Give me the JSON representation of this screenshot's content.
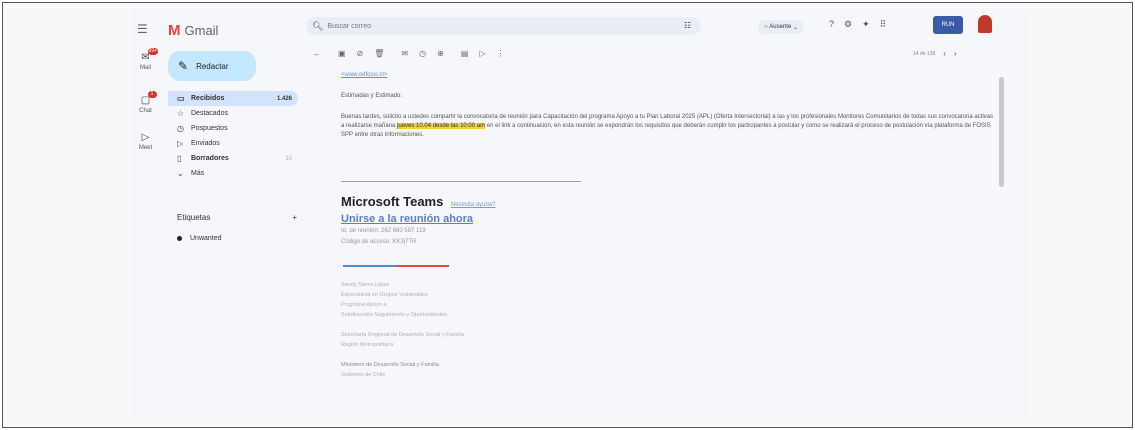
{
  "app": {
    "name": "Gmail"
  },
  "rail": {
    "items": [
      {
        "label": "Mail",
        "badge": "99+"
      },
      {
        "label": "Chat",
        "badge": "1"
      },
      {
        "label": "Meet",
        "badge": ""
      }
    ]
  },
  "compose": {
    "label": "Redactar"
  },
  "nav": {
    "items": [
      {
        "label": "Recibidos",
        "count": "1.426",
        "icon": "inbox-icon"
      },
      {
        "label": "Destacados",
        "count": "",
        "icon": "star-icon"
      },
      {
        "label": "Pospuestos",
        "count": "",
        "icon": "clock-icon"
      },
      {
        "label": "Enviados",
        "count": "",
        "icon": "send-icon"
      },
      {
        "label": "Borradores",
        "count": "10",
        "icon": "draft-icon"
      },
      {
        "label": "Más",
        "count": "",
        "icon": "chevron-down-icon"
      }
    ]
  },
  "labels": {
    "heading": "Etiquetas",
    "add": "+",
    "items": [
      "Unwanted"
    ]
  },
  "search": {
    "placeholder": "Buscar correo"
  },
  "status": {
    "label": "Ausente"
  },
  "user": {
    "org": "RUN"
  },
  "pager": {
    "text": "14 de 138"
  },
  "email": {
    "link": "<www.odfosis.cl>",
    "greeting": "Estimadas y Estimado:",
    "body_before": "Buenas tardes, solicito a ustedes compartir la convocatoria de reunión para Capacitación del programa Apoyo a tu Plan Laboral 2025 (APL) (Oferta Intersectorial) a las y los profesionales Monitores Comunitarios de todas sus convocatoria activas a realizarse mañana ",
    "body_highlight": "jueves 10.04 desde las 10:00 am",
    "body_after": " en el link a continuación, en esta reunión se expondrán los requisitos que deberán cumplir los participantes a postular y como se realizará el proceso de postulación vía plataforma de FOSIS SPP entre otras informaciones."
  },
  "teams": {
    "title": "Microsoft Teams",
    "help": "Necesita ayuda?",
    "join": "Unirse a la reunión ahora",
    "meeting_id": "Id. de reunión: 262 680 587 119",
    "passcode": "Código de acceso: KK3j7TR"
  },
  "signature": {
    "lines": [
      "Sandy Sierra López",
      "Especialista en Grupos Vulnerables",
      "Programa Apoyo a",
      "Subdirección Seguimiento y Oportunidades",
      "",
      "Secretaría Regional de Desarrollo Social y Familia",
      "Región Metropolitana",
      "",
      "Ministerio de Desarrollo Social y Familia",
      "Gobierno de Chile"
    ]
  }
}
